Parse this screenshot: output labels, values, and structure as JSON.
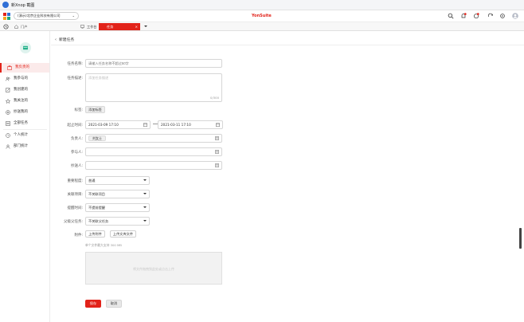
{
  "window": {
    "title": "新Xnop 截图"
  },
  "topnav": {
    "tenant": "(演示)北京企业科技有限公司",
    "brand": "YonSuite"
  },
  "tabs": [
    {
      "label": "门户"
    },
    {
      "label": "工作台"
    },
    {
      "label": "任务"
    }
  ],
  "sidebar": {
    "items": [
      {
        "label": "我负责的"
      },
      {
        "label": "我参与的"
      },
      {
        "label": "我创建的"
      },
      {
        "label": "我关注的"
      },
      {
        "label": "抄送我的"
      },
      {
        "label": "全部任务"
      },
      {
        "label": "个人统计"
      },
      {
        "label": "部门统计"
      }
    ]
  },
  "page": {
    "back_title": "新建任务"
  },
  "form": {
    "name": {
      "label": "任务名称:",
      "placeholder": "请输入任务名称不超过50字"
    },
    "desc": {
      "label": "任务描述:",
      "placeholder": "添加任务描述",
      "counter": "0/300"
    },
    "tag": {
      "label": "标签:",
      "button": "添加标签"
    },
    "deadline": {
      "label": "起止时间:",
      "start": "2021-03-09 17:10",
      "end": "2021-03-11 17:10"
    },
    "owner": {
      "label": "负责人:",
      "chip": "刘女士"
    },
    "participant": {
      "label": "参与人:"
    },
    "cc": {
      "label": "抄送人:"
    },
    "priority": {
      "label": "重要程度:",
      "value": "普通"
    },
    "project": {
      "label": "关联项目:",
      "value": "不关联项目"
    },
    "remind": {
      "label": "提醒时间:",
      "value": "不提前提醒"
    },
    "parent": {
      "label": "父级父任务:",
      "value": "不关联父任务"
    },
    "attach": {
      "label": "附件:",
      "upload": "上传附件",
      "upload_doc": "上传文库文件",
      "hint": "单个文件最大支持 300 MB",
      "drop": "将文件拖拽到此处或点击上传"
    },
    "save": "保存",
    "cancel": "取消"
  },
  "colors": {
    "accent": "#e2231a",
    "active_bg": "#fbeaea"
  }
}
